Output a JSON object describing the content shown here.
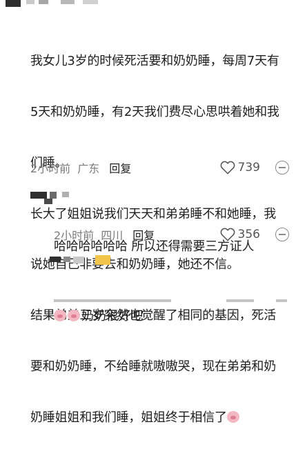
{
  "comments": [
    {
      "lines": [
        "我女儿3岁的时候死活要和奶奶睡，每周7天有",
        "5天和奶奶睡，有2天我们费尽心思哄着她和我",
        "们睡。",
        "长大了姐姐说我们天天和弟弟睡不和她睡，我",
        "说她自己非要去和奶奶睡，她还不信。",
        "结果弟弟三岁突然也觉醒了相同的基因，死活",
        "要和奶奶睡，不给睡就嗷嗷哭，现在弟弟和奶",
        "奶睡姐姐和我们睡，姐姐终于相信了"
      ],
      "time": "2小时前",
      "location": "广东",
      "reply_label": "回复",
      "likes": "739"
    },
    {
      "lines": [
        "哈哈哈哈哈哈 所以还得需要三方证人"
      ],
      "time": "2小时前",
      "location": "四川",
      "reply_label": "回复",
      "likes": "356"
    },
    {
      "lines": [
        "奶奶很好吧"
      ],
      "time": "",
      "location": "",
      "reply_label": "",
      "likes": ""
    }
  ],
  "icons": {
    "like": "heart-outline-icon",
    "more": "more-options-icon",
    "emoji": "laughing-face-emoji-icon"
  },
  "colors": {
    "text": "#1f1f1f",
    "meta": "#7a7a7a",
    "name_blocks": "#2e2e2e",
    "name_blocks_gray": "#b8b8b8",
    "name_block_yellow": "#f2c54a"
  }
}
